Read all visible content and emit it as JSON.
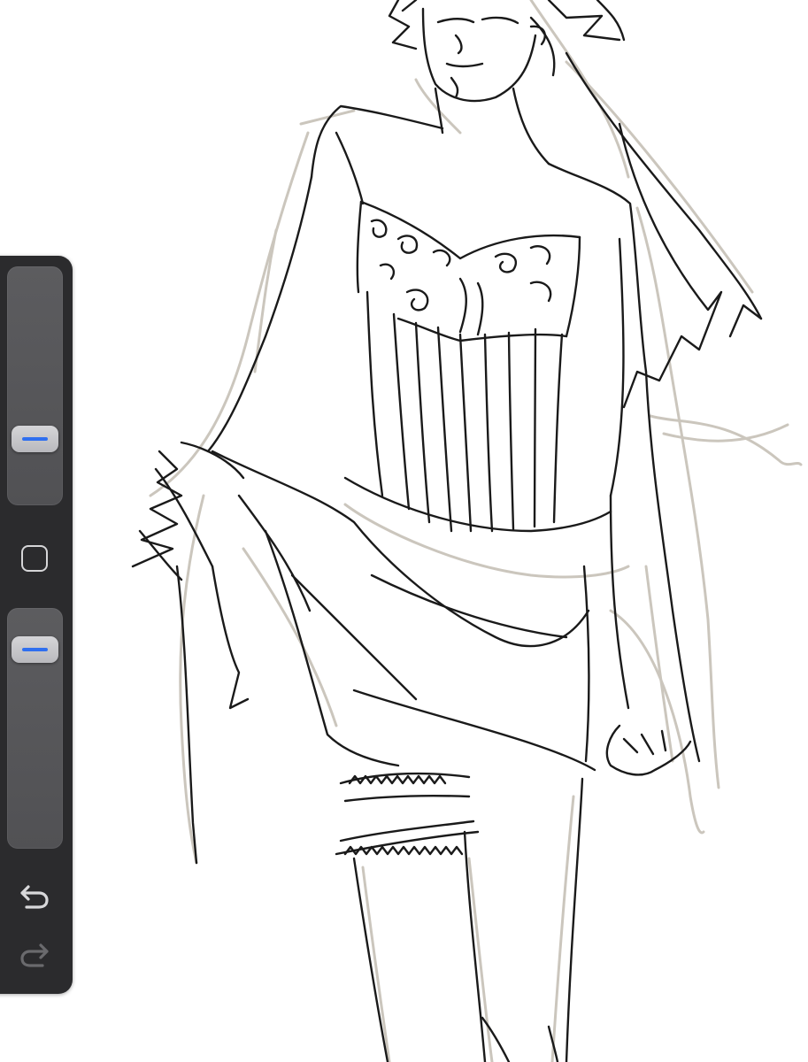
{
  "app": {
    "name": "",
    "canvas_background": "#ffffff",
    "sketch_color": "#1a1a1a",
    "underlay_color": "#cbc6bd"
  },
  "sidebar": {
    "brush_size": {
      "label": "",
      "level": 0.24,
      "accent": "#2f6fef"
    },
    "modify": {
      "icon": "square-outline-icon"
    },
    "opacity": {
      "label": "",
      "level": 0.88,
      "accent": "#2f6fef"
    },
    "undo": {
      "icon": "undo-arrow-icon",
      "enabled": true,
      "color": "#d8d8da"
    },
    "redo": {
      "icon": "redo-arrow-icon",
      "enabled": false,
      "color": "#6a6a6d"
    }
  },
  "canvas": {
    "subject": "pencil-sketch-figure"
  }
}
